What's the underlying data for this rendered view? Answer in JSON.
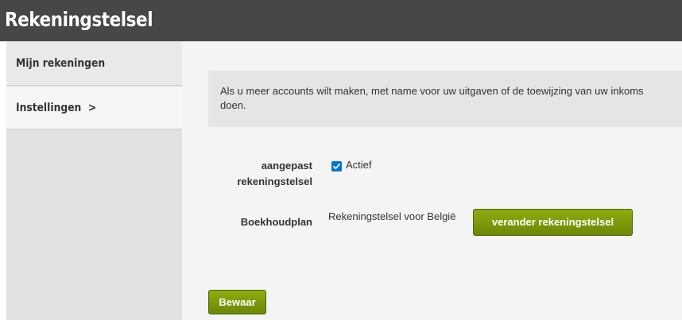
{
  "header": {
    "title": "Rekeningstelsel"
  },
  "sidebar": {
    "items": [
      {
        "label": "Mijn rekeningen"
      },
      {
        "label": "Instellingen  >"
      }
    ]
  },
  "main": {
    "info": {
      "line1": "Als u meer accounts wilt maken, met name voor uw uitgaven of de toewijzing van uw inkoms",
      "line2": "doen."
    },
    "custom_field": {
      "label_line1": "aangepast",
      "label_line2": "rekeningstelsel",
      "checkbox_label": "Actief",
      "checked": true
    },
    "plan_field": {
      "label": "Boekhoudplan",
      "value": "Rekeningstelsel voor België",
      "change_button": "verander rekeningstelsel"
    },
    "save_button": "Bewaar"
  },
  "colors": {
    "header_bg": "#474747",
    "button_green": "#7a9a0b",
    "checkbox_blue": "#0075d9"
  }
}
